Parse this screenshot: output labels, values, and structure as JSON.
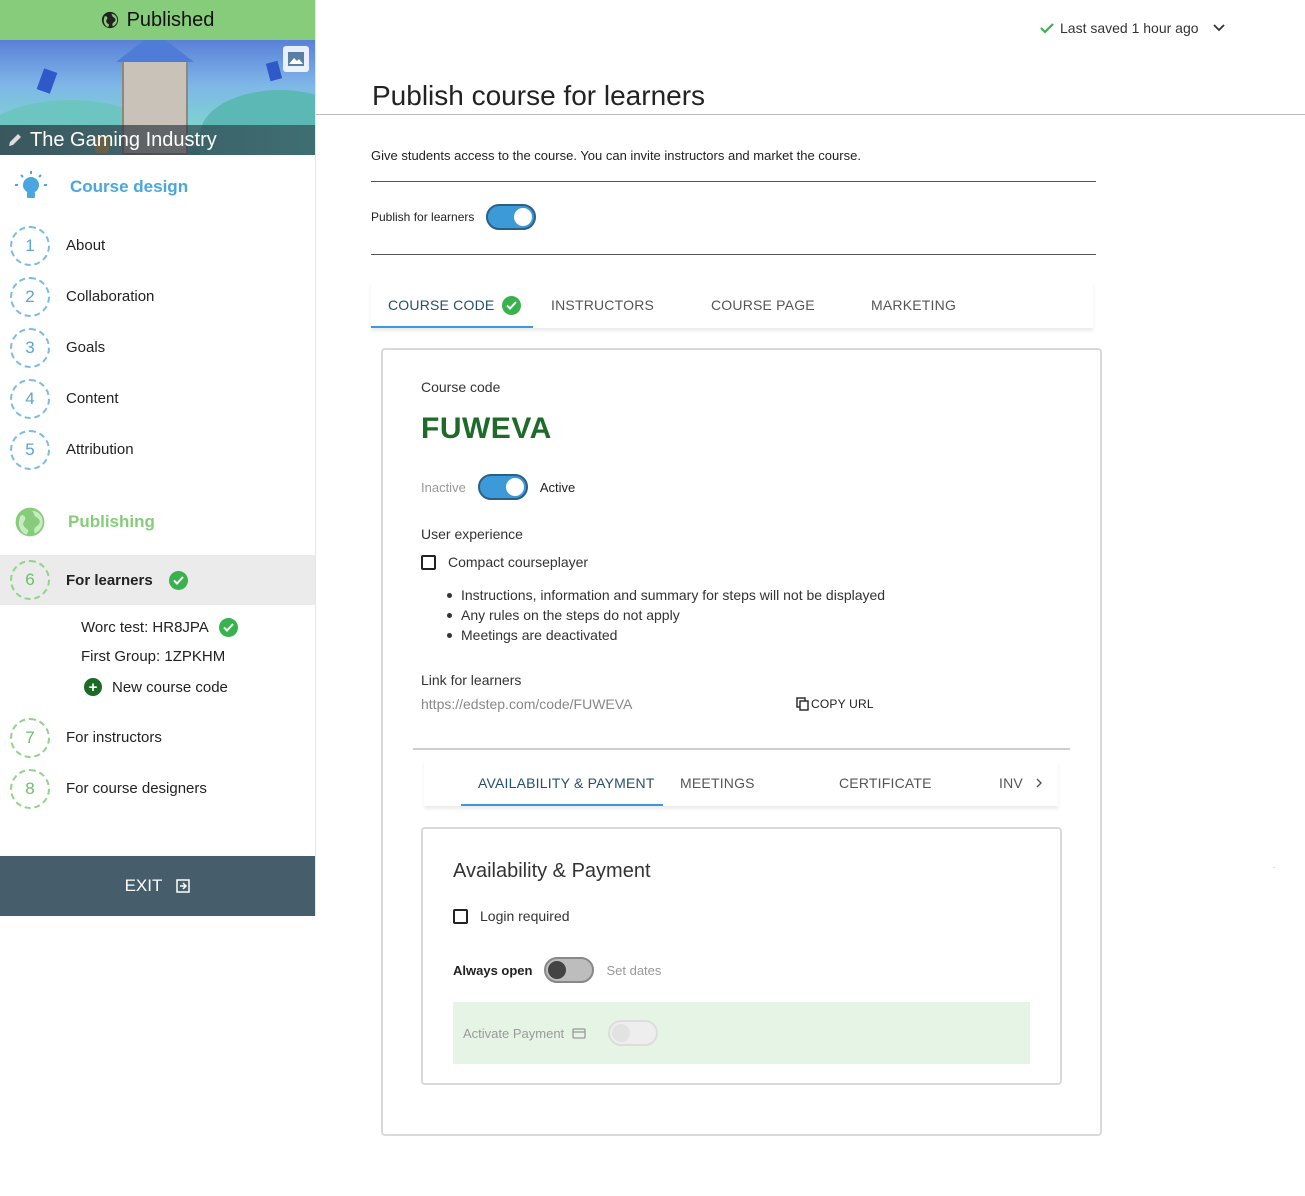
{
  "status_banner": {
    "label": "Published"
  },
  "course": {
    "title": "The Gaming Industry"
  },
  "sidebar": {
    "course_design_header": "Course design",
    "design_steps": [
      {
        "num": "1",
        "label": "About"
      },
      {
        "num": "2",
        "label": "Collaboration"
      },
      {
        "num": "3",
        "label": "Goals"
      },
      {
        "num": "4",
        "label": "Content"
      },
      {
        "num": "5",
        "label": "Attribution"
      }
    ],
    "publishing_header": "Publishing",
    "publishing_steps": [
      {
        "num": "6",
        "label": "For learners"
      },
      {
        "num": "7",
        "label": "For instructors"
      },
      {
        "num": "8",
        "label": "For course designers"
      }
    ],
    "sub_items": [
      "Worc test: HR8JPA",
      "First Group: 1ZPKHM"
    ],
    "new_code_label": "New course code",
    "exit_label": "EXIT"
  },
  "saved_status": "Last saved 1 hour ago",
  "main": {
    "title": "Publish course for learners",
    "description": "Give students access to the course. You can invite instructors and market the course.",
    "publish_label": "Publish for learners",
    "publish_on": true,
    "tabs": [
      "COURSE CODE",
      "INSTRUCTORS",
      "COURSE PAGE",
      "MARKETING"
    ],
    "active_tab": "COURSE CODE"
  },
  "code_card": {
    "label": "Course code",
    "code": "FUWEVA",
    "inactive_label": "Inactive",
    "active_label": "Active",
    "is_active": true,
    "user_experience_label": "User experience",
    "compact_label": "Compact courseplayer",
    "compact_checked": false,
    "bullets": [
      "Instructions, information and summary for steps will not be displayed",
      "Any rules on the steps do not apply",
      "Meetings are deactivated"
    ],
    "link_label": "Link for learners",
    "link_url": "https://edstep.com/code/FUWEVA",
    "copy_label": "COPY URL"
  },
  "sub_tabs": [
    "AVAILABILITY & PAYMENT",
    "MEETINGS",
    "CERTIFICATE",
    "INV"
  ],
  "availability": {
    "title": "Availability & Payment",
    "login_label": "Login required",
    "login_checked": false,
    "always_open_label": "Always open",
    "set_dates_label": "Set dates",
    "payment_label": "Activate Payment"
  },
  "colors": {
    "published_banner": "#86cc7a",
    "accent_blue": "#3d9ad9",
    "code_green": "#1e6a2b",
    "exit_bar": "#465d6c",
    "payment_bg": "#e6f4e6"
  }
}
